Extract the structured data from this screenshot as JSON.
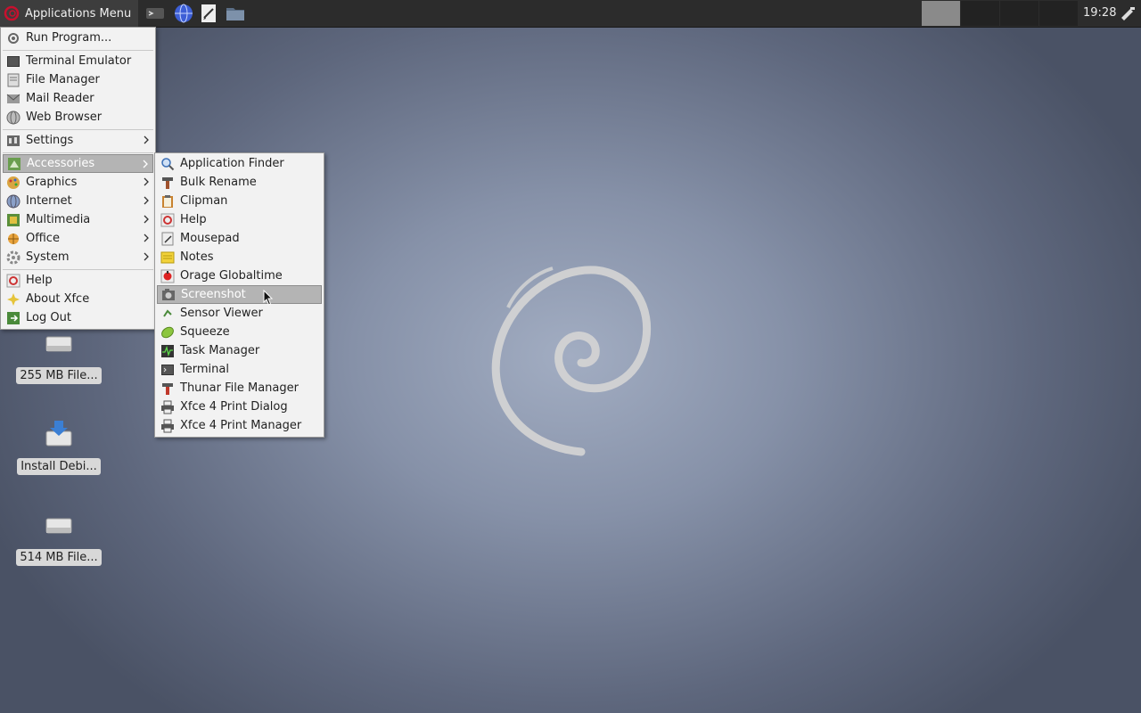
{
  "panel": {
    "app_menu_label": "Applications Menu",
    "clock": "19:28"
  },
  "desktop": {
    "icons": [
      {
        "label": "255 MB File..."
      },
      {
        "label": "Install Debi..."
      },
      {
        "label": "514 MB File..."
      }
    ]
  },
  "applications_menu": {
    "items": [
      {
        "label": "Run Program...",
        "icon": "run-icon"
      },
      {
        "label": "Terminal Emulator",
        "icon": "terminal-icon"
      },
      {
        "label": "File Manager",
        "icon": "file-manager-icon"
      },
      {
        "label": "Mail Reader",
        "icon": "mail-icon"
      },
      {
        "label": "Web Browser",
        "icon": "globe-icon"
      },
      {
        "label": "Settings",
        "icon": "settings-icon"
      },
      {
        "label": "Accessories",
        "icon": "accessories-icon"
      },
      {
        "label": "Graphics",
        "icon": "graphics-icon"
      },
      {
        "label": "Internet",
        "icon": "internet-icon"
      },
      {
        "label": "Multimedia",
        "icon": "multimedia-icon"
      },
      {
        "label": "Office",
        "icon": "office-icon"
      },
      {
        "label": "System",
        "icon": "system-icon"
      },
      {
        "label": "Help",
        "icon": "help-icon"
      },
      {
        "label": "About Xfce",
        "icon": "star-icon"
      },
      {
        "label": "Log Out",
        "icon": "logout-icon"
      }
    ]
  },
  "accessories_menu": {
    "items": [
      {
        "label": "Application Finder"
      },
      {
        "label": "Bulk Rename"
      },
      {
        "label": "Clipman"
      },
      {
        "label": "Help"
      },
      {
        "label": "Mousepad"
      },
      {
        "label": "Notes"
      },
      {
        "label": "Orage Globaltime"
      },
      {
        "label": "Screenshot"
      },
      {
        "label": "Sensor Viewer"
      },
      {
        "label": "Squeeze"
      },
      {
        "label": "Task Manager"
      },
      {
        "label": "Terminal"
      },
      {
        "label": "Thunar File Manager"
      },
      {
        "label": "Xfce 4 Print Dialog"
      },
      {
        "label": "Xfce 4 Print Manager"
      }
    ]
  },
  "colors": {
    "panel": "#2c2c2c",
    "menu_bg": "#f2f2f2",
    "highlight": "#b4b4b4"
  }
}
